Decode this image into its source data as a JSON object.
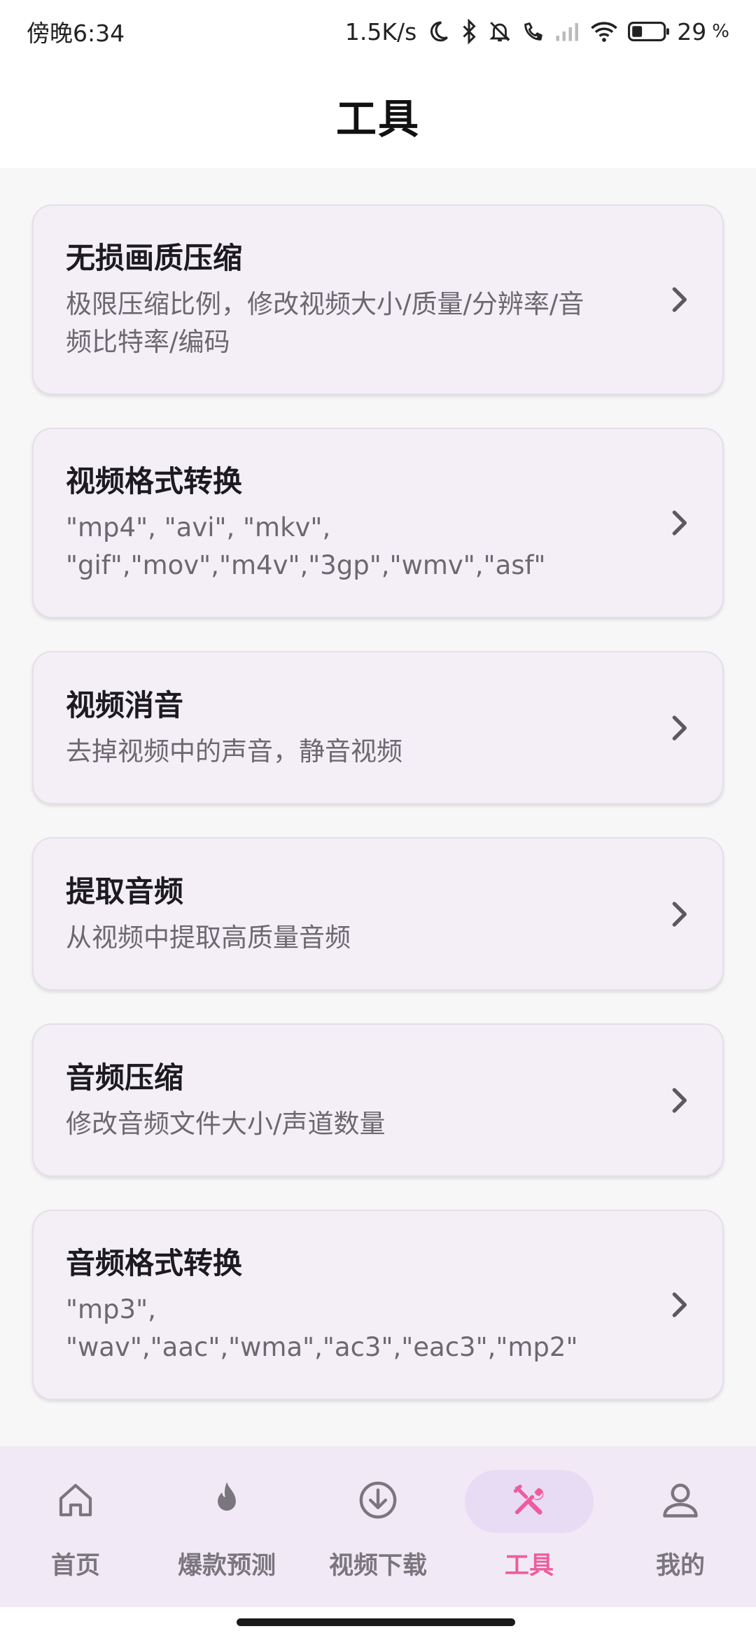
{
  "status_bar": {
    "time": "傍晚6:34",
    "speed": "1.5K/s",
    "battery": "29",
    "battery_unit": "%"
  },
  "header": {
    "title": "工具"
  },
  "tools": [
    {
      "title": "无损画质压缩",
      "desc": "极限压缩比例，修改视频大小/质量/分辨率/音\n频比特率/编码"
    },
    {
      "title": "视频格式转换",
      "desc": "\"mp4\", \"avi\", \"mkv\",\n\"gif\",\"mov\",\"m4v\",\"3gp\",\"wmv\",\"asf\""
    },
    {
      "title": "视频消音",
      "desc": "去掉视频中的声音，静音视频"
    },
    {
      "title": "提取音频",
      "desc": "从视频中提取高质量音频"
    },
    {
      "title": "音频压缩",
      "desc": "修改音频文件大小/声道数量"
    },
    {
      "title": "音频格式转换",
      "desc": "\"mp3\",\n\"wav\",\"aac\",\"wma\",\"ac3\",\"eac3\",\"mp2\""
    }
  ],
  "nav": {
    "items": [
      {
        "label": "首页",
        "icon": "home-icon"
      },
      {
        "label": "爆款预测",
        "icon": "fire-icon"
      },
      {
        "label": "视频下载",
        "icon": "download-icon"
      },
      {
        "label": "工具",
        "icon": "tools-icon",
        "active": true
      },
      {
        "label": "我的",
        "icon": "person-icon"
      }
    ],
    "active_color": "#ee5c9c",
    "inactive_color": "#7a767e"
  }
}
